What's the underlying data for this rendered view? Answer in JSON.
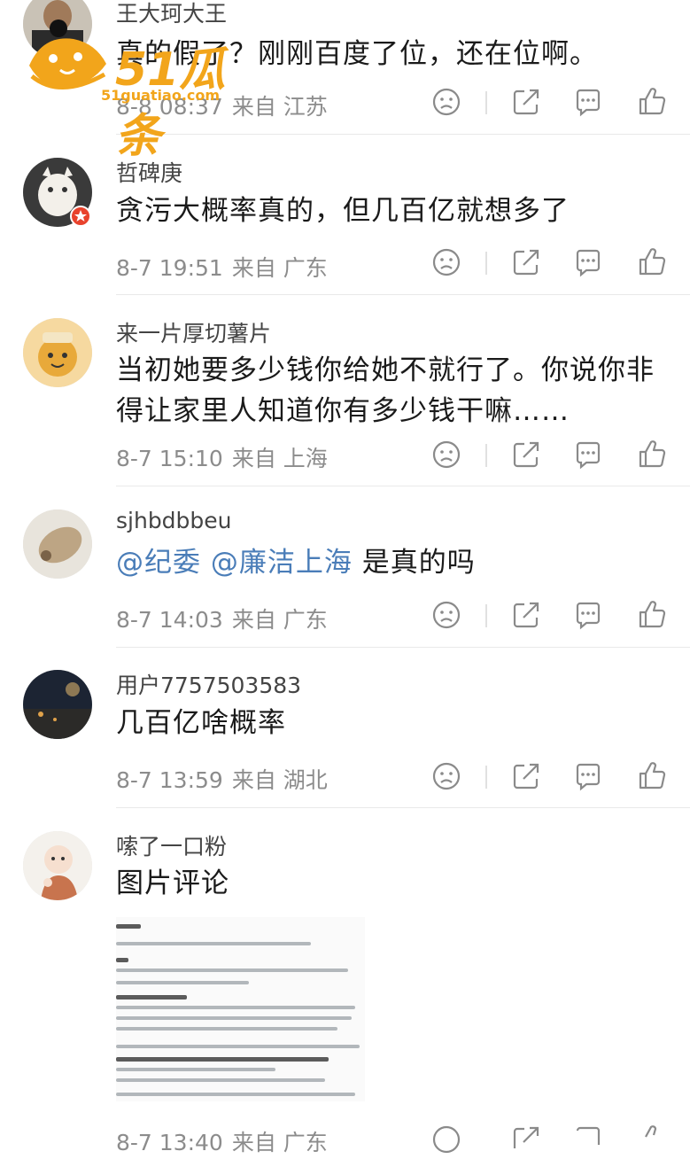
{
  "colors": {
    "mention": "#4a7db8",
    "meta": "#8c8c8c",
    "watermark": "#f2a51b"
  },
  "watermark": {
    "brand": "51瓜条",
    "url": "51guatiao.com"
  },
  "icons": [
    "dislike-face-icon",
    "share-icon",
    "comment-icon",
    "like-thumb-icon"
  ],
  "comments": [
    {
      "username": "王大珂大王",
      "text": "真的假了？刚刚百度了位，还在位啊。",
      "time": "8-8 08:37",
      "location": "来自 江苏"
    },
    {
      "username": "哲碑庚",
      "text": "贪污大概率真的，但几百亿就想多了",
      "time": "8-7 19:51",
      "location": "来自 广东"
    },
    {
      "username": "来一片厚切薯片",
      "text": "当初她要多少钱你给她不就行了。你说你非得让家里人知道你有多少钱干嘛……",
      "time": "8-7 15:10",
      "location": "来自 上海"
    },
    {
      "username": "sjhbdbbeu",
      "mention1": "@纪委",
      "mention2": "@廉洁上海",
      "text": "是真的吗",
      "time": "8-7 14:03",
      "location": "来自 广东"
    },
    {
      "username": "用户7757503583",
      "text": "几百亿啥概率",
      "time": "8-7 13:59",
      "location": "来自 湖北"
    },
    {
      "username": "嗦了一口粉",
      "text": "图片评论",
      "time": "8-7 13:40",
      "location": "来自 广东"
    }
  ]
}
